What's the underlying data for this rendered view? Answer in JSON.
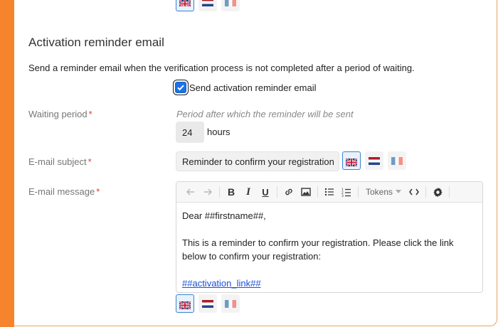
{
  "section": {
    "title": "Activation reminder email",
    "description": "Send a reminder email when the verification process is not completed after a period of waiting."
  },
  "checkbox": {
    "label": "Send activation reminder email",
    "checked": true
  },
  "fields": {
    "waiting_period": {
      "label": "Waiting period",
      "required_mark": "*",
      "hint": "Period after which the reminder will be sent",
      "value": "24",
      "unit": "hours"
    },
    "subject": {
      "label": "E-mail subject",
      "required_mark": "*",
      "value": "Reminder to confirm your registration"
    },
    "message": {
      "label": "E-mail message",
      "required_mark": "*",
      "toolbar": {
        "items": [
          "undo-icon",
          "redo-icon",
          "bold-icon",
          "italic-icon",
          "underline-icon",
          "link-icon",
          "image-icon",
          "bullet-list-icon",
          "numbered-list-icon",
          "code-icon",
          "gear-icon"
        ],
        "tokens_label": "Tokens"
      },
      "body": {
        "greeting": "Dear ##firstname##,",
        "paragraph": "This is a reminder to confirm your registration. Please click the link below to confirm your registration:",
        "link": "##activation_link##"
      }
    }
  },
  "languages": [
    "en",
    "nl",
    "fr"
  ],
  "colors": {
    "accent": "#f5842c",
    "primary": "#1a73e8",
    "required": "#e53935",
    "link": "#1a4fd6"
  }
}
